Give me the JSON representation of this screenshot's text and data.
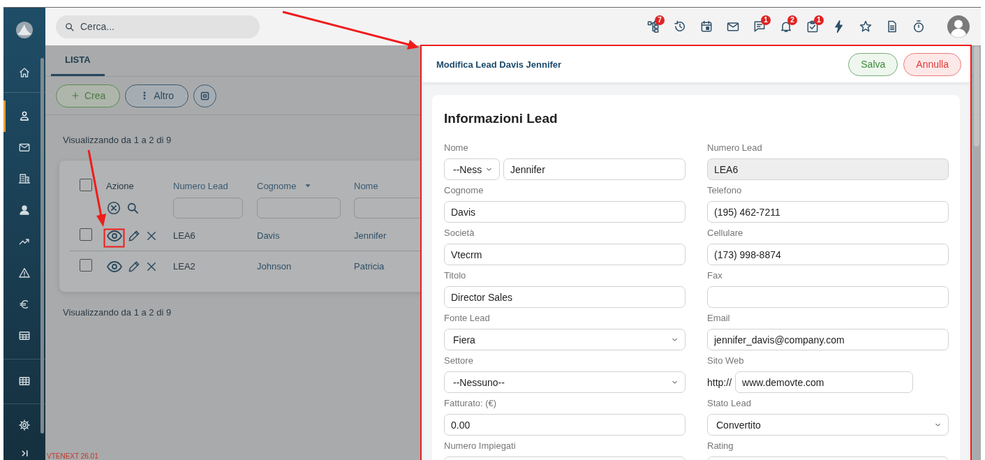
{
  "sidebar": {
    "groups": [
      {
        "items": [
          {
            "kind": "home",
            "selected": false
          }
        ]
      },
      {
        "items": [
          {
            "kind": "contact",
            "selected": true
          },
          {
            "kind": "mail",
            "selected": false
          },
          {
            "kind": "building",
            "selected": false
          },
          {
            "kind": "user",
            "selected": false
          },
          {
            "kind": "trend",
            "selected": false
          },
          {
            "kind": "warning",
            "selected": false
          },
          {
            "kind": "euro",
            "selected": false
          },
          {
            "kind": "table",
            "selected": false
          }
        ]
      },
      {
        "items": [
          {
            "kind": "grid",
            "selected": false
          }
        ]
      },
      {
        "items": [
          {
            "kind": "gear",
            "selected": false
          }
        ]
      }
    ]
  },
  "topbar": {
    "search": {
      "placeholder": "Cerca..."
    },
    "icons": [
      {
        "kind": "hierarchy",
        "badge": "7"
      },
      {
        "kind": "history"
      },
      {
        "kind": "calendar"
      },
      {
        "kind": "mail"
      },
      {
        "kind": "chat",
        "badge": "1"
      },
      {
        "kind": "bell",
        "badge": "2"
      },
      {
        "kind": "task",
        "badge": "1"
      },
      {
        "kind": "bolt"
      },
      {
        "kind": "star"
      },
      {
        "kind": "document"
      },
      {
        "kind": "timer"
      }
    ]
  },
  "list": {
    "tabs": [
      {
        "label": "LISTA",
        "selected": true
      }
    ],
    "buttons": [
      {
        "kind": "create",
        "label": "Crea"
      },
      {
        "kind": "more",
        "label": "Altro"
      },
      {
        "kind": "settings"
      }
    ],
    "summary_top": "Visualizzando da 1 a 2 di 9",
    "table": {
      "select_all": {
        "checked": false
      },
      "action_column": {
        "label": "Azione"
      },
      "columns": [
        {
          "label": "Numero Lead",
          "sorted": false
        },
        {
          "label": "Cognome",
          "sorted": true
        },
        {
          "label": "Nome",
          "sorted": false
        }
      ],
      "rows": [
        {
          "checked": false,
          "cells": [
            "LEA6",
            "Davis",
            "Jennifer"
          ]
        },
        {
          "checked": false,
          "cells": [
            "LEA2",
            "Johnson",
            "Patricia"
          ]
        }
      ]
    },
    "summary_bottom": "Visualizzando da 1 a 2 di 9",
    "version": "VTENEXT 26.01"
  },
  "panel": {
    "title": "Modifica Lead Davis Jennifer",
    "buttons": [
      {
        "kind": "save",
        "label": "Salva"
      },
      {
        "kind": "cancel",
        "label": "Annulla"
      }
    ],
    "section": {
      "title": "Informazioni Lead",
      "columns": [
        [
          {
            "label": "Nome",
            "kind": "salutation",
            "option": "--Ness",
            "value": "Jennifer"
          },
          {
            "label": "Cognome",
            "kind": "text",
            "value": "Davis"
          },
          {
            "label": "Società",
            "kind": "text",
            "value": "Vtecrm"
          },
          {
            "label": "Titolo",
            "kind": "text",
            "value": "Director Sales"
          },
          {
            "label": "Fonte Lead",
            "kind": "select",
            "value": "Fiera"
          },
          {
            "label": "Settore",
            "kind": "select",
            "value": "--Nessuno--"
          },
          {
            "label": "Fatturato: (€)",
            "kind": "text",
            "value": "0.00"
          },
          {
            "label": "Numero Impiegati",
            "kind": "text"
          }
        ],
        [
          {
            "label": "Numero Lead",
            "kind": "readonly",
            "value": "LEA6"
          },
          {
            "label": "Telefono",
            "kind": "text",
            "value": "(195) 462-7211"
          },
          {
            "label": "Cellulare",
            "kind": "text",
            "value": "(173) 998-8874"
          },
          {
            "label": "Fax",
            "kind": "text"
          },
          {
            "label": "Email",
            "kind": "text",
            "value": "jennifer_davis@company.com"
          },
          {
            "label": "Sito Web",
            "kind": "url",
            "prefix": "http://",
            "value": "www.demovte.com"
          },
          {
            "label": "Stato Lead",
            "kind": "select",
            "value": "Convertito"
          },
          {
            "label": "Rating",
            "kind": "text"
          }
        ]
      ]
    }
  }
}
